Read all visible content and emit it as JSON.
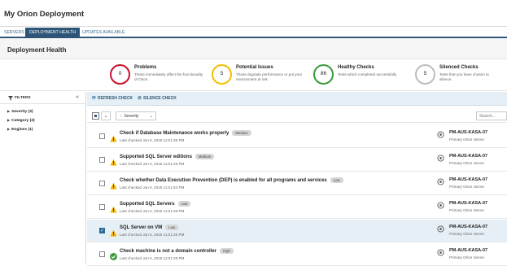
{
  "app": {
    "title": "My Orion Deployment"
  },
  "tabs": [
    {
      "label": "SERVERS"
    },
    {
      "label": "DEPLOYMENT HEALTH"
    },
    {
      "label": "UPDATES AVAILABLE"
    }
  ],
  "section": {
    "title": "Deployment Health"
  },
  "summary": [
    {
      "count": "0",
      "title": "Problems",
      "desc": "These immediately affect the functionality of Orion",
      "color": "#c8102e"
    },
    {
      "count": "5",
      "title": "Potential Issues",
      "desc": "These degrade performance or put your environment at risk",
      "color": "#f0c000"
    },
    {
      "count": "86",
      "title": "Healthy Checks",
      "desc": "Tests which completed successfully",
      "color": "#3a9a3a"
    },
    {
      "count": "5",
      "title": "Silenced Checks",
      "desc": "Tests that you have chosen to silence.",
      "color": "#bdbdbd"
    }
  ],
  "filters": {
    "title": "FILTERS",
    "collapse_icon": "double-chevron-left-icon",
    "items": [
      {
        "label": "Severity (3)"
      },
      {
        "label": "Category (3)"
      },
      {
        "label": "Engines (1)"
      }
    ]
  },
  "actions": {
    "refresh": "REFRESH CHECK",
    "silence": "SILENCE CHECK"
  },
  "toolbar": {
    "sort_label": "Severity",
    "search_placeholder": "Search..."
  },
  "rows": [
    {
      "title": "Check if Database Maintenance works properly",
      "severity": "Medium",
      "status": "warning",
      "checked": "Last checked Jun 5, 2018 11:01:35 PM",
      "server": "PM-AUS-KASA-07",
      "role": "Primary Orion Server",
      "selected": false
    },
    {
      "title": "Supported SQL Server editions",
      "severity": "Medium",
      "status": "warning",
      "checked": "Last checked Jun 5, 2018 11:01:28 PM",
      "server": "PM-AUS-KASA-07",
      "role": "Primary Orion Server",
      "selected": false
    },
    {
      "title": "Check whether Data Execution Prevention (DEP) is enabled for all programs and services",
      "severity": "Low",
      "status": "warning",
      "checked": "Last checked Jun 5, 2018 11:01:53 PM",
      "server": "PM-AUS-KASA-07",
      "role": "Primary Orion Server",
      "selected": false
    },
    {
      "title": "Supported SQL Servers",
      "severity": "Low",
      "status": "warning",
      "checked": "Last checked Jun 5, 2018 11:01:28 PM",
      "server": "PM-AUS-KASA-07",
      "role": "Primary Orion Server",
      "selected": false
    },
    {
      "title": "SQL Server on VM",
      "severity": "Low",
      "status": "warning",
      "checked": "Last checked Jun 5, 2018 11:01:28 PM",
      "server": "PM-AUS-KASA-07",
      "role": "Primary Orion Server",
      "selected": true
    },
    {
      "title": "Check machine is not a domain controller",
      "severity": "High",
      "status": "ok",
      "checked": "Last checked Jun 5, 2018 11:01:29 PM",
      "server": "PM-AUS-KASA-07",
      "role": "Primary Orion Server",
      "selected": false
    }
  ]
}
